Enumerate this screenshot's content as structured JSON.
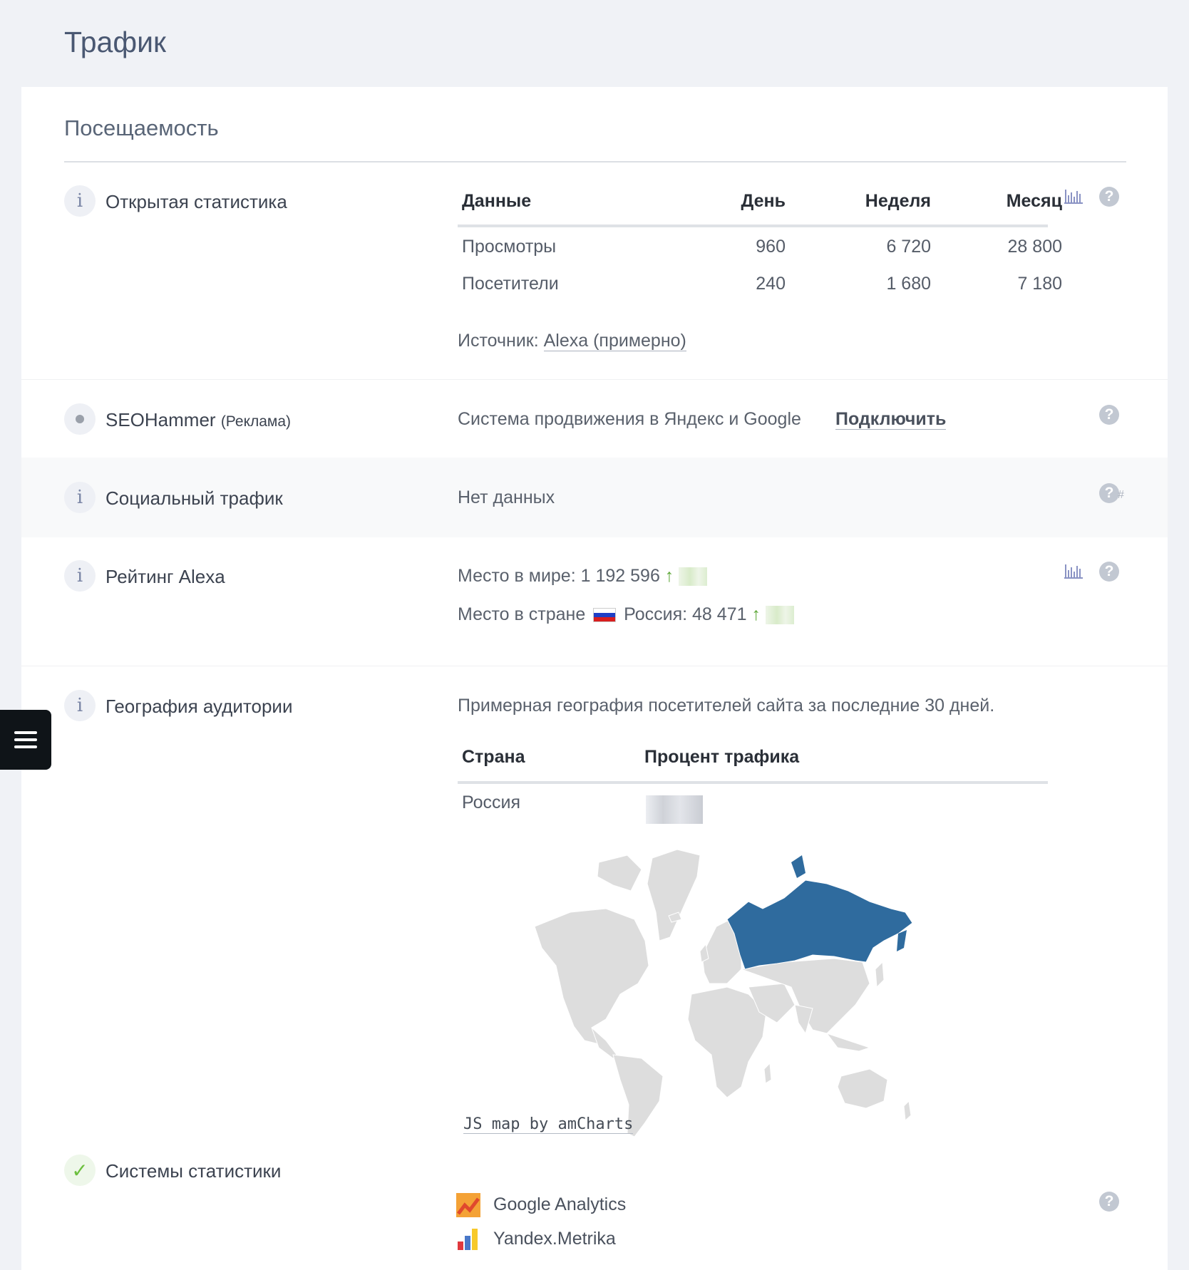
{
  "page": {
    "title": "Трафик"
  },
  "section": {
    "title": "Посещаемость"
  },
  "open_stats": {
    "label": "Открытая статистика",
    "headers": [
      "Данные",
      "День",
      "Неделя",
      "Месяц"
    ],
    "rows": [
      [
        "Просмотры",
        "960",
        "6 720",
        "28 800"
      ],
      [
        "Посетители",
        "240",
        "1 680",
        "7 180"
      ]
    ],
    "source_prefix": "Источник:",
    "source_link": "Alexa (примерно)"
  },
  "seohammer": {
    "label": "SEOHammer",
    "label_small": "(Реклама)",
    "text": "Система продвижения в Яндекс и Google",
    "action": "Подключить"
  },
  "social": {
    "label": "Социальный трафик",
    "value": "Нет данных"
  },
  "alexa": {
    "label": "Рейтинг Alexa",
    "world_prefix": "Место в мире:",
    "world_value": "1 192 596",
    "country_prefix": "Место в стране",
    "country_name": "Россия:",
    "country_value": "48 471"
  },
  "geo": {
    "label": "География аудитории",
    "description": "Примерная география посетителей сайта за последние 30 дней.",
    "headers": [
      "Страна",
      "Процент трафика"
    ],
    "rows": [
      [
        "Россия",
        ""
      ]
    ],
    "map_credit": "JS map by amCharts",
    "highlight_color": "#2f6b9e",
    "land_color": "#dddddd"
  },
  "systems": {
    "label": "Системы статистики",
    "items": [
      "Google Analytics",
      "Yandex.Metrika"
    ]
  },
  "icons": {
    "info": "info-icon",
    "help": "question-icon",
    "chart": "bar-chart-icon",
    "check": "check-icon",
    "menu": "hamburger-icon"
  }
}
